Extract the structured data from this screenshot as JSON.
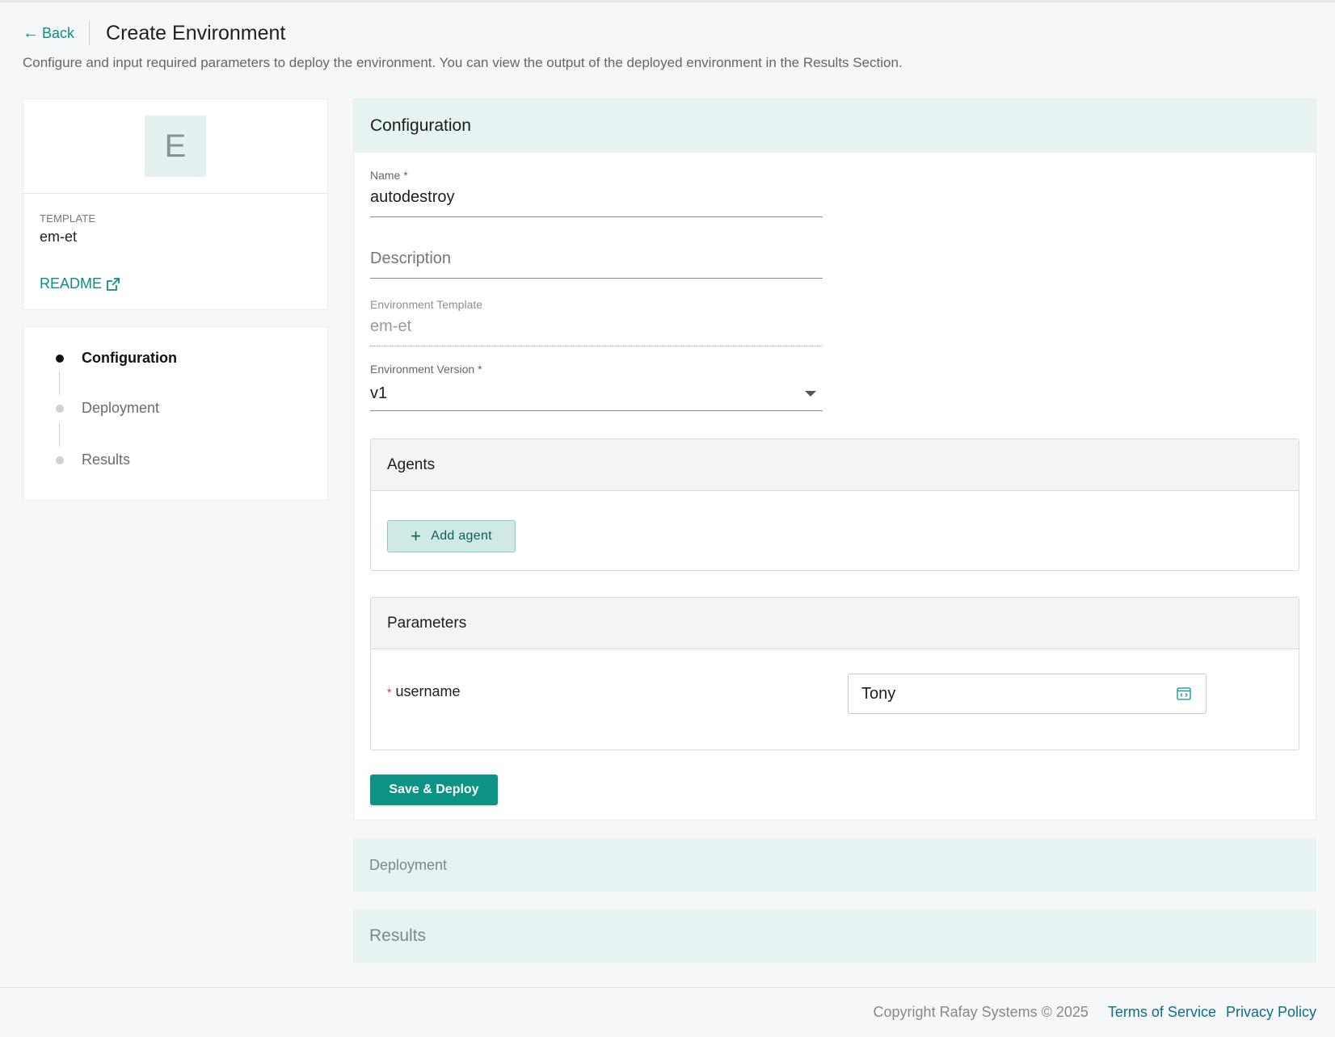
{
  "header": {
    "back_label": "Back",
    "title": "Create Environment",
    "subtitle": "Configure and input required parameters to deploy the environment. You can view the output of the deployed environment in the Results Section."
  },
  "template_card": {
    "avatar_letter": "E",
    "template_label": "TEMPLATE",
    "template_value": "em-et",
    "readme_label": "README"
  },
  "stepper": {
    "steps": [
      {
        "label": "Configuration",
        "active": true
      },
      {
        "label": "Deployment",
        "active": false
      },
      {
        "label": "Results",
        "active": false
      }
    ]
  },
  "configuration": {
    "title": "Configuration",
    "name_label": "Name *",
    "name_value": "autodestroy",
    "description_placeholder": "Description",
    "env_template_label": "Environment Template",
    "env_template_value": "em-et",
    "env_version_label": "Environment Version *",
    "env_version_value": "v1",
    "agents": {
      "title": "Agents",
      "add_label": "Add agent"
    },
    "parameters": {
      "title": "Parameters",
      "required_mark": "*",
      "param_name": "username",
      "param_value": "Tony"
    },
    "save_label": "Save & Deploy"
  },
  "deployment_panel": {
    "title": "Deployment"
  },
  "results_panel": {
    "title": "Results"
  },
  "footer": {
    "copyright": "Copyright Rafay Systems © 2025",
    "terms": "Terms of Service",
    "privacy": "Privacy Policy"
  },
  "colors": {
    "accent": "#0c9385",
    "panel_header_bg": "#e6f3f2",
    "link": "#0c6e8a"
  }
}
